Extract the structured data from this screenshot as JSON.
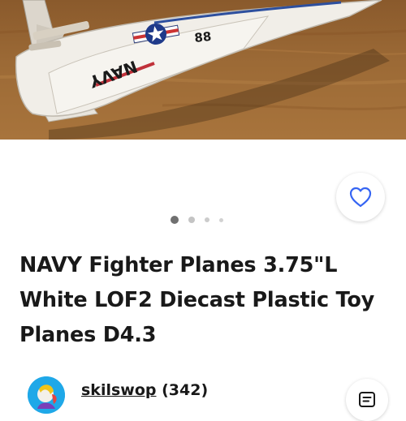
{
  "listing": {
    "title": "NAVY Fighter Planes 3.75\"L White LOF2 Diecast Plastic Toy Planes D4.3",
    "image": {
      "markings": {
        "number": "88",
        "service": "NAVY"
      }
    },
    "carousel": {
      "total_dots": 4,
      "active_index": 0
    }
  },
  "seller": {
    "handle": "skilswop",
    "feedback_count": "(342)"
  },
  "colors": {
    "title_text": "#191919",
    "heart_icon": "#3665f3",
    "avatar_bg": "#1fa8e8",
    "wood_bg": "#9c6a36"
  },
  "icons": {
    "watch": "heart-icon",
    "message": "message-icon"
  }
}
